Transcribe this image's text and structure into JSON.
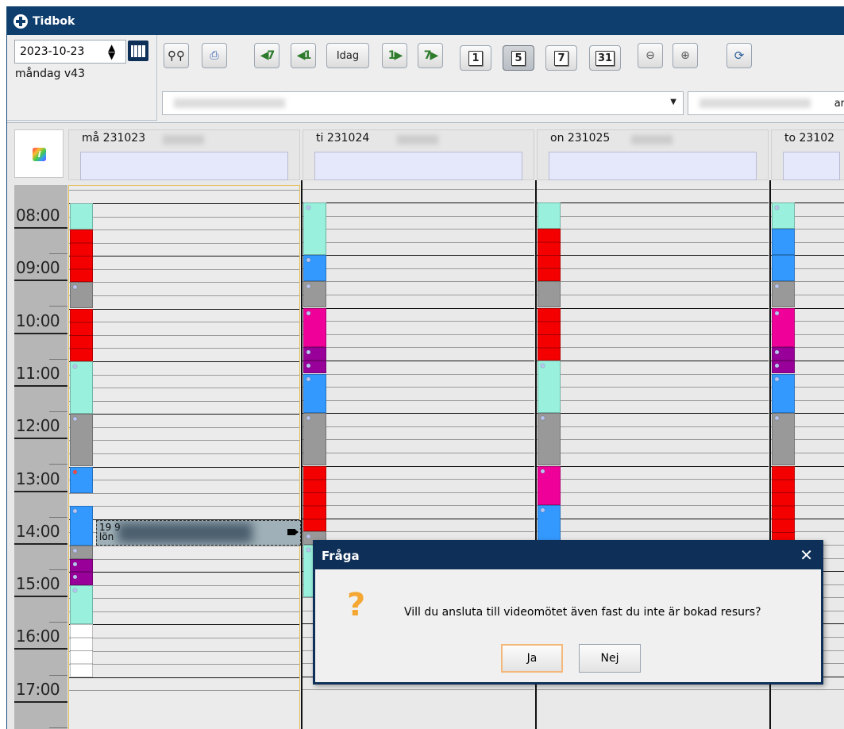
{
  "app": {
    "title": "Tidbok"
  },
  "date_picker": {
    "value": "2023-10-23",
    "week_label": "måndag v43"
  },
  "toolbar": {
    "today_label": "Idag",
    "view_1_day": "1",
    "view_5_day": "5",
    "view_7_day": "7",
    "view_month": "31",
    "selected_view": "5",
    "combo2_suffix": "ar"
  },
  "days": [
    {
      "label": "må 231023"
    },
    {
      "label": "ti 231024"
    },
    {
      "label": "on 231025"
    },
    {
      "label": "to 23102"
    }
  ],
  "times": [
    "08:00",
    "09:00",
    "10:00",
    "11:00",
    "12:00",
    "13:00",
    "14:00",
    "15:00",
    "16:00",
    "17:00"
  ],
  "appointment_card": {
    "line1": "19 9",
    "line2": "lön"
  },
  "colors": {
    "cyan": "#99f0dc",
    "red": "#f40000",
    "gray": "#999999",
    "blue": "#3399ff",
    "magenta": "#ee0099",
    "purple": "#990099",
    "white": "#ffffff"
  },
  "dialog": {
    "title": "Fråga",
    "message": "Vill du ansluta till videomötet även fast du inte är bokad resurs?",
    "yes_label": "Ja",
    "no_label": "Nej"
  }
}
